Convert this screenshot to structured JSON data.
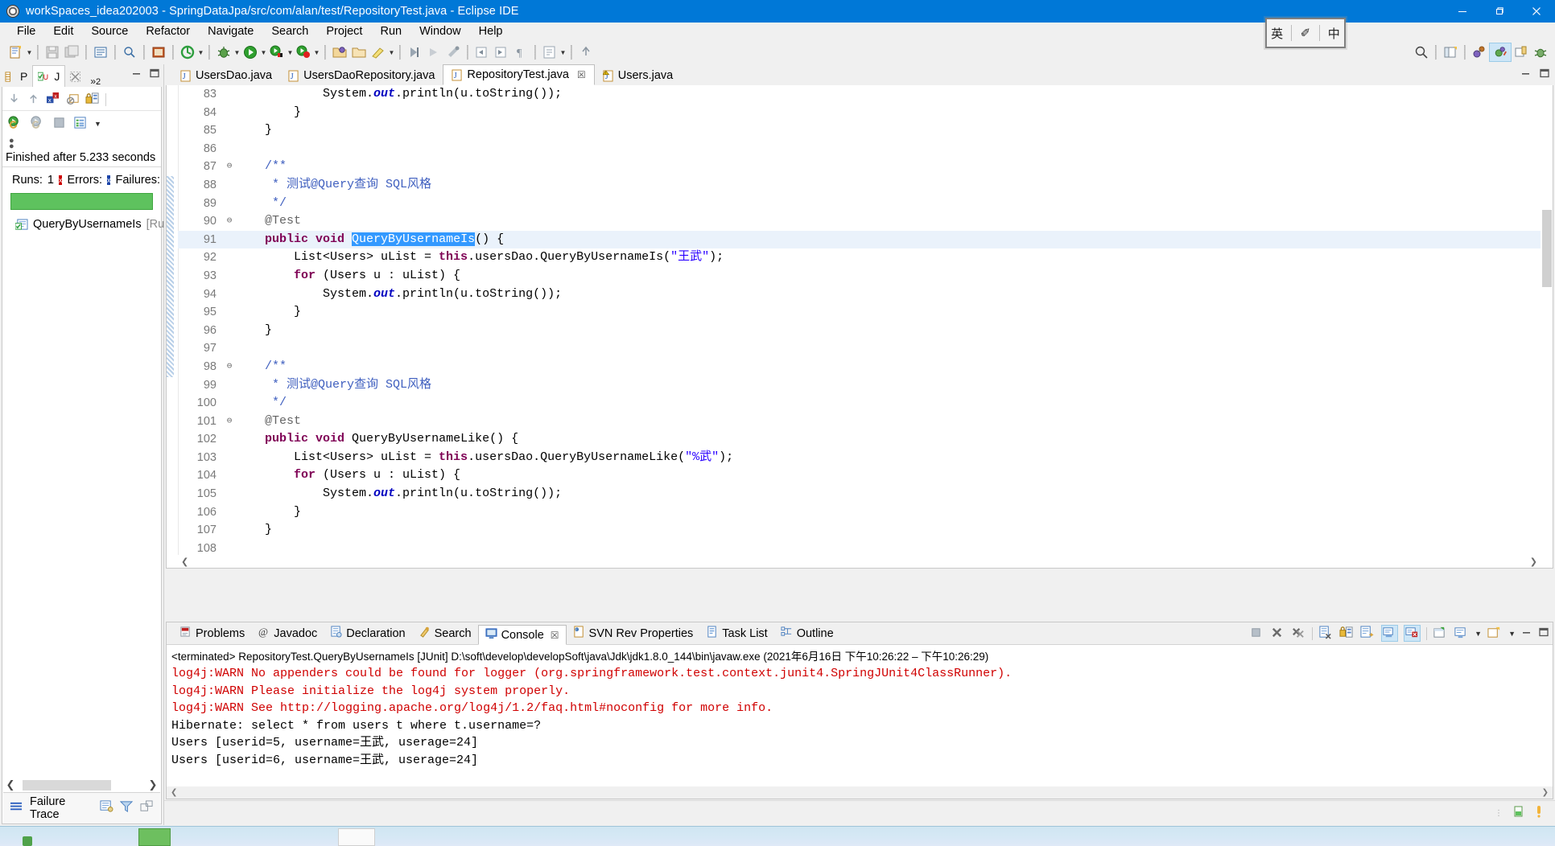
{
  "window": {
    "title": "workSpaces_idea202003 - SpringDataJpa/src/com/alan/test/RepositoryTest.java - Eclipse IDE",
    "minimize": "—",
    "maximize": "❐",
    "close": "✕"
  },
  "menubar": {
    "items": [
      "File",
      "Edit",
      "Source",
      "Refactor",
      "Navigate",
      "Search",
      "Project",
      "Run",
      "Window",
      "Help"
    ]
  },
  "ime": {
    "english": "英",
    "pen": "✐",
    "chinese": "中"
  },
  "junit_view": {
    "tabs": [
      {
        "label": "P",
        "icon": "package-explorer-icon",
        "active": false
      },
      {
        "label": "J",
        "icon": "junit-icon",
        "active": true
      },
      {
        "label": "",
        "icon": "close-icon",
        "active": false
      }
    ],
    "overflow": "»",
    "overflow_count": "2",
    "status": "Finished after 5.233 seconds",
    "runs_label": "Runs:",
    "runs_value": "1",
    "errors_label": "Errors:",
    "failures_label": "Failures:",
    "progress_color": "#5ec25e",
    "tree_items": [
      {
        "label": "QueryByUsernameIs",
        "suffix": "[Run"
      }
    ],
    "failure_trace_label": "Failure Trace"
  },
  "editor": {
    "tabs": [
      {
        "label": "UsersDao.java",
        "active": false,
        "closable": false,
        "warning": false
      },
      {
        "label": "UsersDaoRepository.java",
        "active": false,
        "closable": false,
        "warning": false
      },
      {
        "label": "RepositoryTest.java",
        "active": true,
        "closable": true,
        "warning": false
      },
      {
        "label": "Users.java",
        "active": false,
        "closable": false,
        "warning": true
      }
    ],
    "close_glyph": "☒",
    "lines": [
      {
        "num": "83",
        "fold": "",
        "hl": false,
        "tokens": [
          {
            "t": "            System.",
            "c": "plain"
          },
          {
            "t": "out",
            "c": "fld"
          },
          {
            "t": ".println(u.toString());",
            "c": "plain"
          }
        ]
      },
      {
        "num": "84",
        "fold": "",
        "hl": false,
        "tokens": [
          {
            "t": "        }",
            "c": "plain"
          }
        ]
      },
      {
        "num": "85",
        "fold": "",
        "hl": false,
        "tokens": [
          {
            "t": "    }",
            "c": "plain"
          }
        ]
      },
      {
        "num": "86",
        "fold": "",
        "hl": false,
        "tokens": [
          {
            "t": "",
            "c": "plain"
          }
        ]
      },
      {
        "num": "87",
        "fold": "⊖",
        "hl": false,
        "tokens": [
          {
            "t": "    /**",
            "c": "cmt-j"
          }
        ]
      },
      {
        "num": "88",
        "fold": "",
        "hl": false,
        "tokens": [
          {
            "t": "     * 测试@Query查询 SQL风格",
            "c": "cmt-j"
          }
        ]
      },
      {
        "num": "89",
        "fold": "",
        "hl": false,
        "tokens": [
          {
            "t": "     */",
            "c": "cmt-j"
          }
        ]
      },
      {
        "num": "90",
        "fold": "⊖",
        "hl": false,
        "tokens": [
          {
            "t": "    @Test",
            "c": "ann"
          }
        ]
      },
      {
        "num": "91",
        "fold": "",
        "hl": true,
        "tokens": [
          {
            "t": "    ",
            "c": "plain"
          },
          {
            "t": "public void ",
            "c": "kw"
          },
          {
            "t": "QueryByUsernameIs",
            "c": "sel"
          },
          {
            "t": "() {",
            "c": "plain"
          }
        ]
      },
      {
        "num": "92",
        "fold": "",
        "hl": false,
        "tokens": [
          {
            "t": "        List<Users> uList = ",
            "c": "plain"
          },
          {
            "t": "this",
            "c": "kw"
          },
          {
            "t": ".usersDao.QueryByUsernameIs(",
            "c": "plain"
          },
          {
            "t": "\"王武\"",
            "c": "str"
          },
          {
            "t": ");",
            "c": "plain"
          }
        ]
      },
      {
        "num": "93",
        "fold": "",
        "hl": false,
        "tokens": [
          {
            "t": "        ",
            "c": "plain"
          },
          {
            "t": "for",
            "c": "kw"
          },
          {
            "t": " (Users u : uList) {",
            "c": "plain"
          }
        ]
      },
      {
        "num": "94",
        "fold": "",
        "hl": false,
        "tokens": [
          {
            "t": "            System.",
            "c": "plain"
          },
          {
            "t": "out",
            "c": "fld"
          },
          {
            "t": ".println(u.toString());",
            "c": "plain"
          }
        ]
      },
      {
        "num": "95",
        "fold": "",
        "hl": false,
        "tokens": [
          {
            "t": "        }",
            "c": "plain"
          }
        ]
      },
      {
        "num": "96",
        "fold": "",
        "hl": false,
        "tokens": [
          {
            "t": "    }",
            "c": "plain"
          }
        ]
      },
      {
        "num": "97",
        "fold": "",
        "hl": false,
        "tokens": [
          {
            "t": "",
            "c": "plain"
          }
        ]
      },
      {
        "num": "98",
        "fold": "⊖",
        "hl": false,
        "tokens": [
          {
            "t": "    /**",
            "c": "cmt-j"
          }
        ]
      },
      {
        "num": "99",
        "fold": "",
        "hl": false,
        "tokens": [
          {
            "t": "     * 测试@Query查询 SQL风格",
            "c": "cmt-j"
          }
        ]
      },
      {
        "num": "100",
        "fold": "",
        "hl": false,
        "tokens": [
          {
            "t": "     */",
            "c": "cmt-j"
          }
        ]
      },
      {
        "num": "101",
        "fold": "⊖",
        "hl": false,
        "tokens": [
          {
            "t": "    @Test",
            "c": "ann"
          }
        ]
      },
      {
        "num": "102",
        "fold": "",
        "hl": false,
        "tokens": [
          {
            "t": "    ",
            "c": "plain"
          },
          {
            "t": "public void ",
            "c": "kw"
          },
          {
            "t": "QueryByUsernameLike() {",
            "c": "plain"
          }
        ]
      },
      {
        "num": "103",
        "fold": "",
        "hl": false,
        "tokens": [
          {
            "t": "        List<Users> uList = ",
            "c": "plain"
          },
          {
            "t": "this",
            "c": "kw"
          },
          {
            "t": ".usersDao.QueryByUsernameLike(",
            "c": "plain"
          },
          {
            "t": "\"%武\"",
            "c": "str"
          },
          {
            "t": ");",
            "c": "plain"
          }
        ]
      },
      {
        "num": "104",
        "fold": "",
        "hl": false,
        "tokens": [
          {
            "t": "        ",
            "c": "plain"
          },
          {
            "t": "for",
            "c": "kw"
          },
          {
            "t": " (Users u : uList) {",
            "c": "plain"
          }
        ]
      },
      {
        "num": "105",
        "fold": "",
        "hl": false,
        "tokens": [
          {
            "t": "            System.",
            "c": "plain"
          },
          {
            "t": "out",
            "c": "fld"
          },
          {
            "t": ".println(u.toString());",
            "c": "plain"
          }
        ]
      },
      {
        "num": "106",
        "fold": "",
        "hl": false,
        "tokens": [
          {
            "t": "        }",
            "c": "plain"
          }
        ]
      },
      {
        "num": "107",
        "fold": "",
        "hl": false,
        "tokens": [
          {
            "t": "    }",
            "c": "plain"
          }
        ]
      },
      {
        "num": "108",
        "fold": "",
        "hl": false,
        "tokens": [
          {
            "t": "",
            "c": "plain"
          }
        ]
      }
    ]
  },
  "console": {
    "tabs": [
      {
        "label": "Problems",
        "icon": "problems-icon",
        "active": false
      },
      {
        "label": "Javadoc",
        "icon": "javadoc-icon",
        "active": false
      },
      {
        "label": "Declaration",
        "icon": "declaration-icon",
        "active": false
      },
      {
        "label": "Search",
        "icon": "search-icon",
        "active": false
      },
      {
        "label": "Console",
        "icon": "console-icon",
        "active": true
      },
      {
        "label": "SVN Rev Properties",
        "icon": "svn-icon",
        "active": false
      },
      {
        "label": "Task List",
        "icon": "tasklist-icon",
        "active": false
      },
      {
        "label": "Outline",
        "icon": "outline-icon",
        "active": false
      }
    ],
    "close_glyph": "☒",
    "header": "<terminated> RepositoryTest.QueryByUsernameIs [JUnit] D:\\soft\\develop\\developSoft\\java\\Jdk\\jdk1.8.0_144\\bin\\javaw.exe  (2021年6月16日 下午10:26:22 – 下午10:26:29)",
    "output": [
      {
        "text": "log4j:WARN No appenders could be found for logger (org.springframework.test.context.junit4.SpringJUnit4ClassRunner).",
        "color": "red"
      },
      {
        "text": "log4j:WARN Please initialize the log4j system properly.",
        "color": "red"
      },
      {
        "text": "log4j:WARN See http://logging.apache.org/log4j/1.2/faq.html#noconfig for more info.",
        "color": "red"
      },
      {
        "text": "Hibernate: select * from users t where  t.username=?",
        "color": "black"
      },
      {
        "text": "Users [userid=5, username=王武, userage=24]",
        "color": "black"
      },
      {
        "text": "Users [userid=6, username=王武, userage=24]",
        "color": "black"
      }
    ]
  },
  "colors": {
    "title_bar": "#0078d7",
    "selection": "#3399ff",
    "current_line": "#eaf2fb",
    "keyword": "#7f0055",
    "string": "#2a00ff",
    "javadoc": "#3f5fbf",
    "error_text": "#d00000",
    "pass_green": "#5ec25e"
  }
}
